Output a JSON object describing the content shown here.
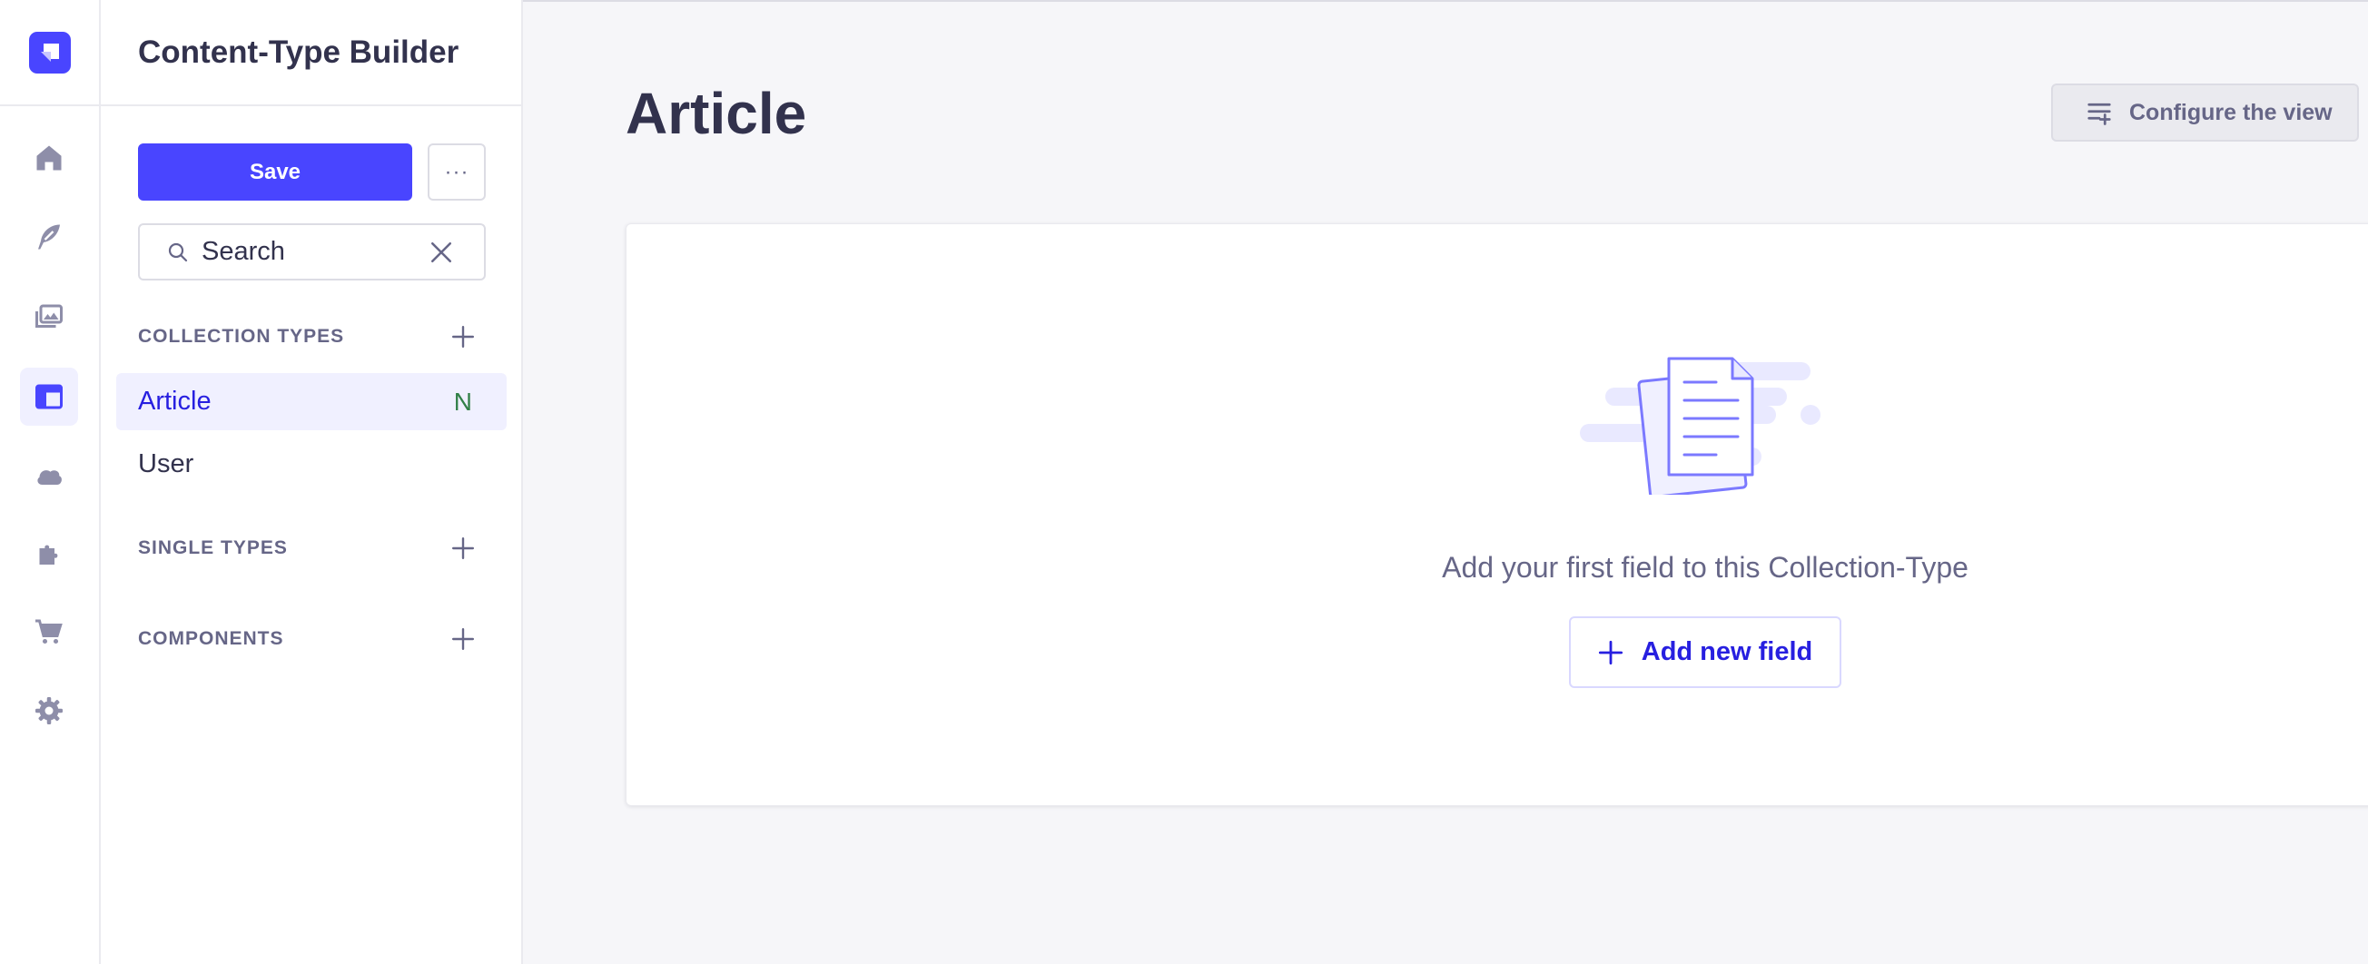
{
  "sidebar": {
    "title": "Content-Type Builder",
    "save_label": "Save",
    "more_label": "···",
    "search": {
      "placeholder": "Search",
      "value": ""
    },
    "sections": {
      "collection_types": "COLLECTION TYPES",
      "single_types": "SINGLE TYPES",
      "components": "COMPONENTS"
    },
    "collection_items": [
      {
        "label": "Article",
        "badge": "N",
        "active": true
      },
      {
        "label": "User",
        "badge": "",
        "active": false
      }
    ]
  },
  "rail": {
    "icons": [
      "logo-icon",
      "home-icon",
      "feather-icon",
      "media-library-icon",
      "content-type-builder-icon",
      "cloud-icon",
      "puzzle-icon",
      "cart-icon",
      "settings-icon"
    ],
    "active": "content-type-builder-icon"
  },
  "main": {
    "title": "Article",
    "configure_label": "Configure the view",
    "empty_message": "Add your first field to this Collection-Type",
    "add_field_label": "Add new field"
  },
  "colors": {
    "primary": "#4945ff",
    "primary_dark": "#271fe0",
    "active_bg": "#f0f0ff",
    "badge_new": "#328048",
    "neutral_text": "#666687"
  }
}
